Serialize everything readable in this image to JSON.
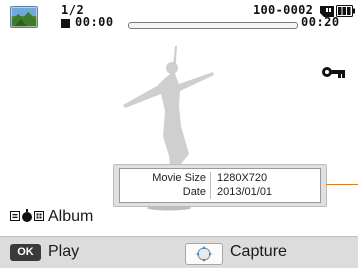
{
  "status_bar": {
    "counter": "1/2",
    "time_elapsed": "00:00",
    "file_number": "100-0002",
    "time_total": "00:20",
    "progress": 0,
    "thumbnail_icon": "landscape-thumbnail",
    "memory_card_icon": "memory-card-icon",
    "battery_icon": "battery-full-icon"
  },
  "preview": {
    "protect_icon": "key-icon",
    "subject": "dancer-silhouette"
  },
  "info": {
    "rows": [
      {
        "label": "Movie Size",
        "value": "1280X720"
      },
      {
        "label": "Date",
        "value": "2013/01/01"
      }
    ],
    "callout_color": "#e07a1f"
  },
  "album": {
    "icon": "album-mode-icon",
    "label": "Album"
  },
  "bottom_bar": {
    "ok_key": "OK",
    "play_label": "Play",
    "dpad_icon": "dpad-icon",
    "capture_label": "Capture"
  }
}
